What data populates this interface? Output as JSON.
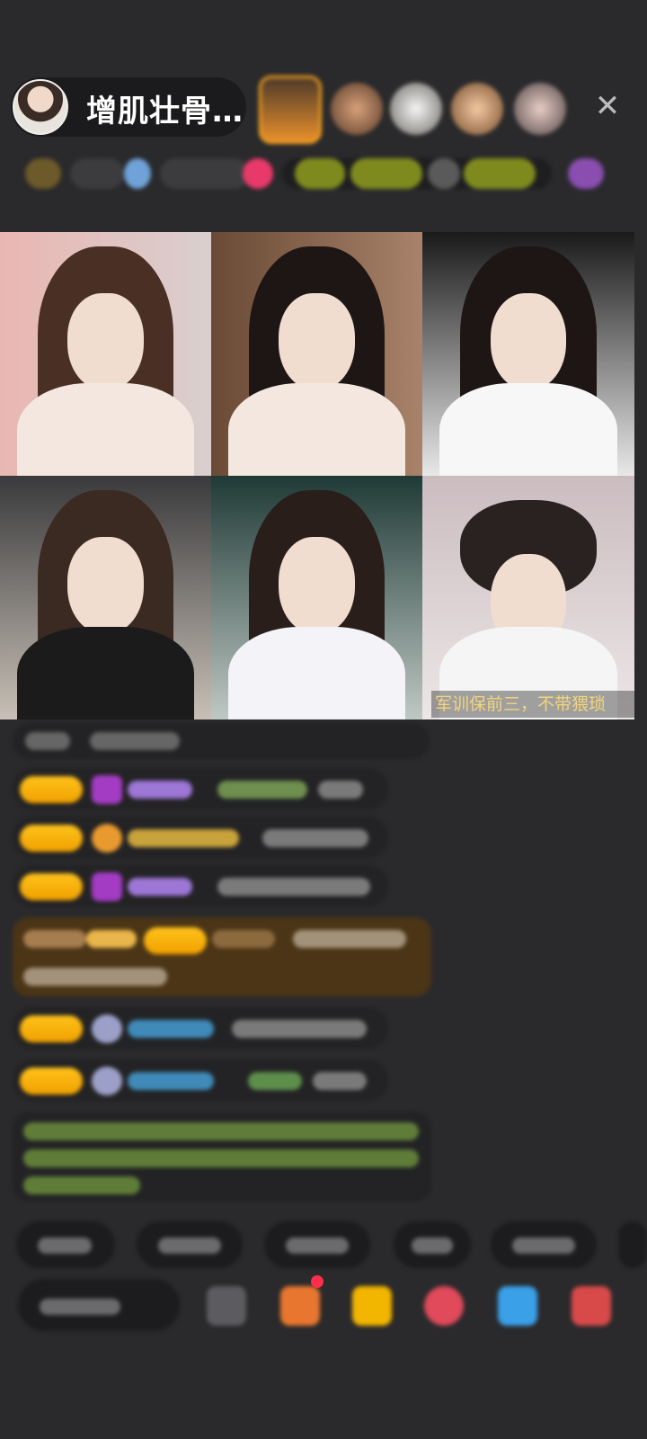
{
  "header": {
    "host_name": "增肌壮骨…",
    "close_icon": "close-icon"
  },
  "video": {
    "caption": "军训保前三，不带猥琐"
  },
  "colors": {
    "background": "#2a2a2c",
    "badge": "#f5ab00",
    "caption": "#f3d57a"
  }
}
